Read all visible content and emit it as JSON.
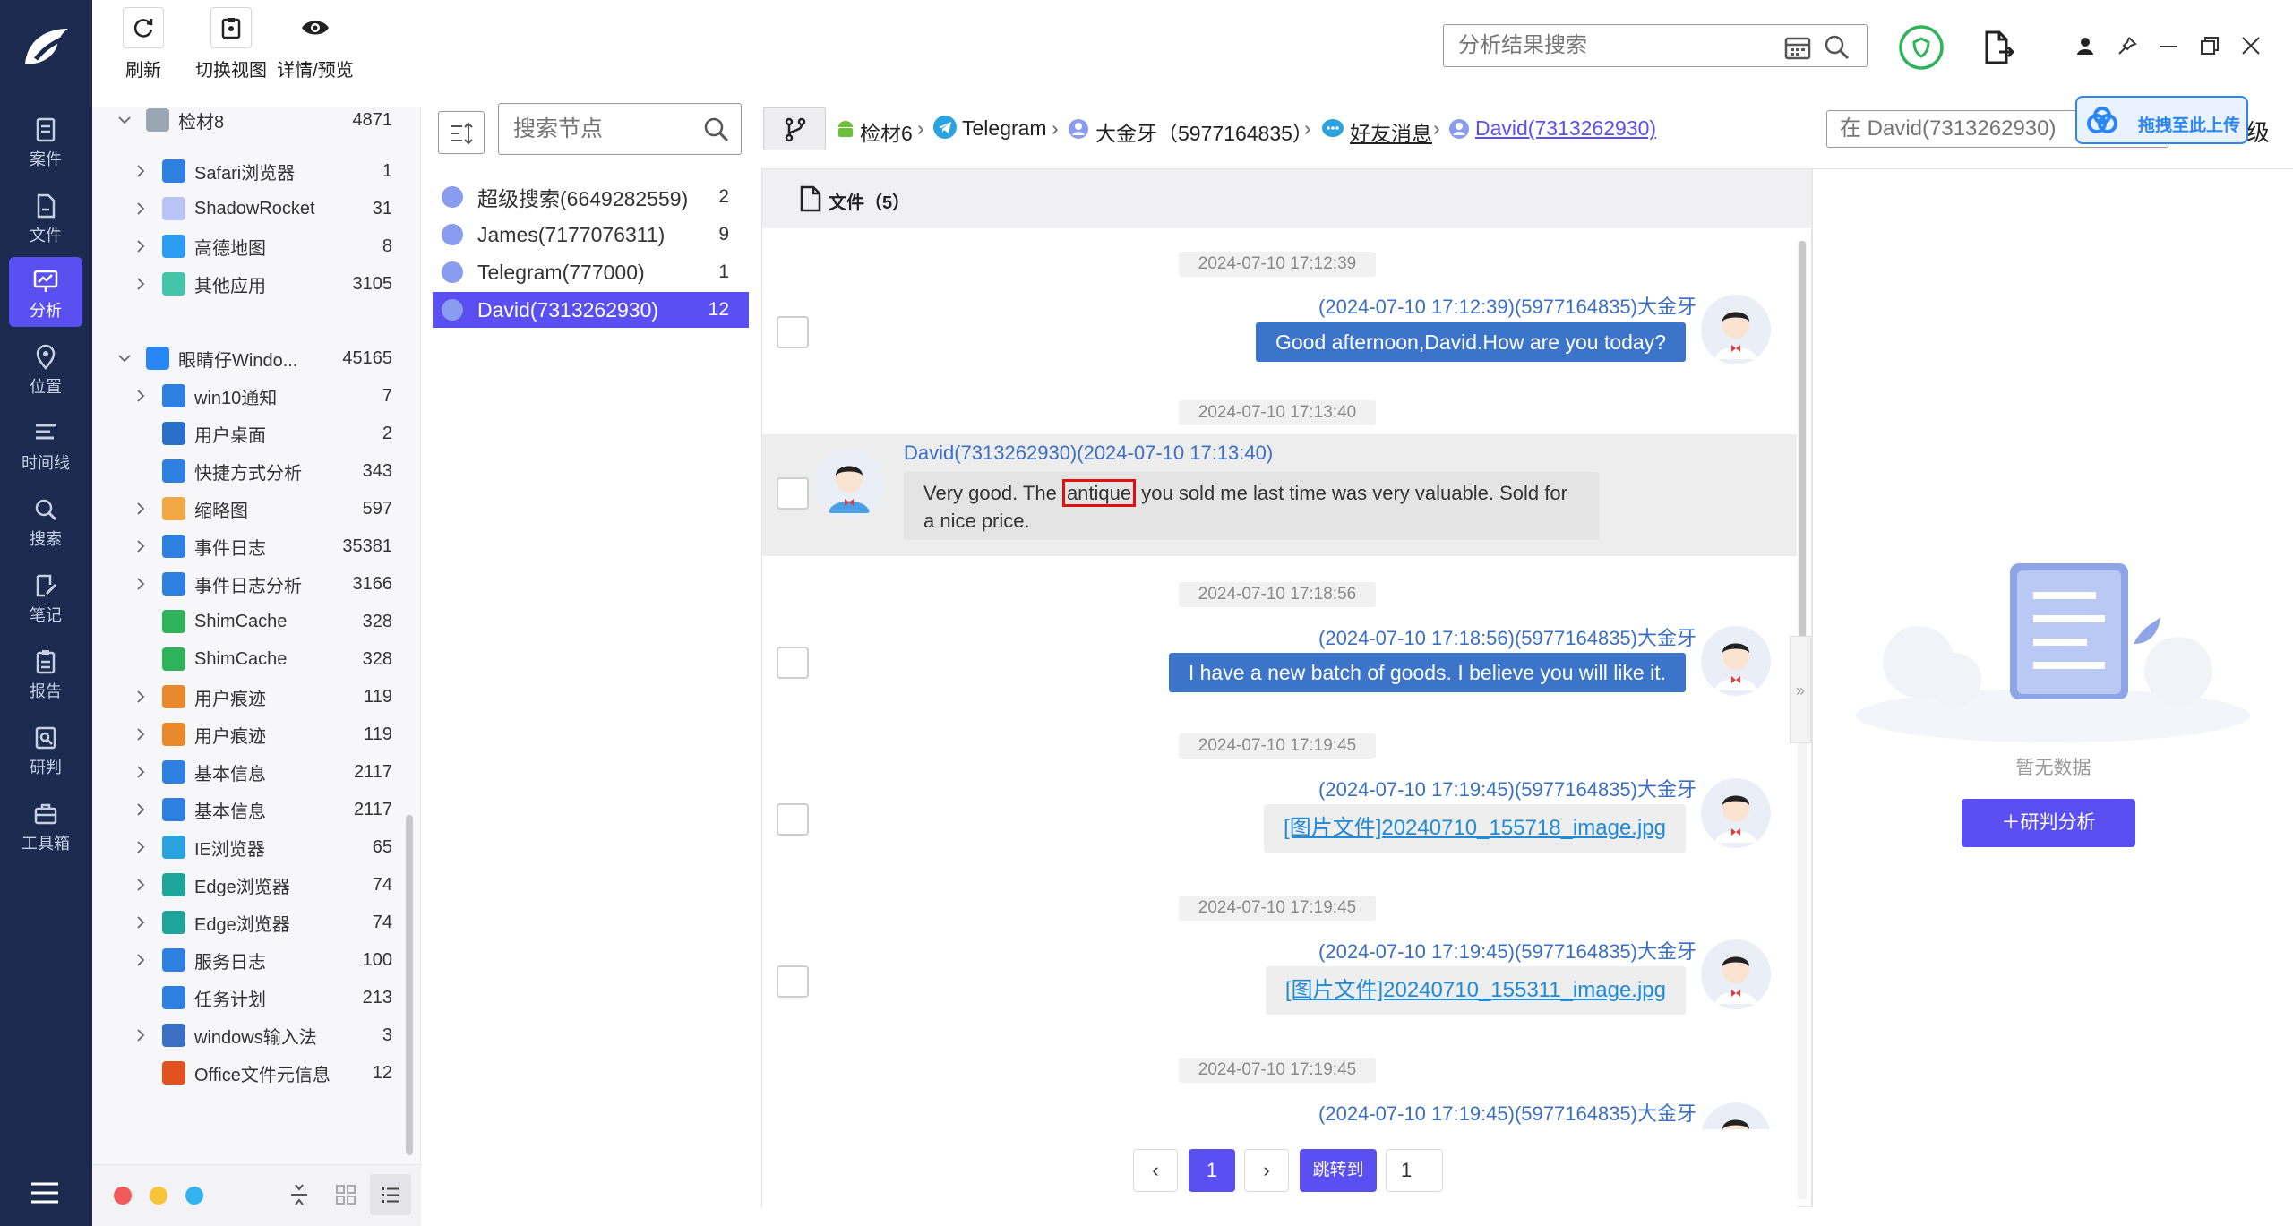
{
  "toolbar": {
    "refresh": "刷新",
    "switch_view": "切换视图",
    "details": "详情/预览",
    "search_placeholder": "分析结果搜索"
  },
  "rail": {
    "items": [
      "案件",
      "文件",
      "分析",
      "位置",
      "时间线",
      "搜索",
      "笔记",
      "报告",
      "研判",
      "工具箱"
    ],
    "active": "分析"
  },
  "tree": {
    "items": [
      {
        "label": "检材8",
        "count": "4871"
      },
      {
        "label": "Safari浏览器",
        "count": "1"
      },
      {
        "label": "ShadowRocket",
        "count": "31"
      },
      {
        "label": "高德地图",
        "count": "8"
      },
      {
        "label": "其他应用",
        "count": "3105"
      },
      {
        "label": "眼睛仔Windo...",
        "count": "45165"
      },
      {
        "label": "win10通知",
        "count": "7"
      },
      {
        "label": "用户桌面",
        "count": "2"
      },
      {
        "label": "快捷方式分析",
        "count": "343"
      },
      {
        "label": "缩略图",
        "count": "597"
      },
      {
        "label": "事件日志",
        "count": "35381"
      },
      {
        "label": "事件日志分析",
        "count": "3166"
      },
      {
        "label": "ShimCache",
        "count": "328"
      },
      {
        "label": "ShimCache",
        "count": "328"
      },
      {
        "label": "用户痕迹",
        "count": "119"
      },
      {
        "label": "用户痕迹",
        "count": "119"
      },
      {
        "label": "基本信息",
        "count": "2117"
      },
      {
        "label": "基本信息",
        "count": "2117"
      },
      {
        "label": "IE浏览器",
        "count": "65"
      },
      {
        "label": "Edge浏览器",
        "count": "74"
      },
      {
        "label": "Edge浏览器",
        "count": "74"
      },
      {
        "label": "服务日志",
        "count": "100"
      },
      {
        "label": "任务计划",
        "count": "213"
      },
      {
        "label": "windows输入法",
        "count": "3"
      },
      {
        "label": "Office文件元信息",
        "count": "12"
      }
    ]
  },
  "nodes": {
    "search_placeholder": "搜索节点",
    "items": [
      {
        "label": "超级搜索(6649282559)",
        "count": "2"
      },
      {
        "label": "James(7177076311)",
        "count": "9"
      },
      {
        "label": "Telegram(777000)",
        "count": "1"
      },
      {
        "label": "David(7313262930)",
        "count": "12"
      }
    ]
  },
  "breadcrumb": {
    "items": [
      "检材6",
      "Telegram",
      "大金牙（5977164835）",
      "好友消息",
      "David(7313262930)"
    ],
    "search_placeholder": "在 David(7313262930)",
    "level_suffix": "级",
    "upload_label": "拖拽至此上传"
  },
  "chat": {
    "header": "文件（5）",
    "messages": [
      {
        "time": "2024-07-10 17:12:39",
        "meta": "(2024-07-10 17:12:39)(5977164835)大金牙",
        "text": "Good afternoon,David.How are you today?"
      },
      {
        "time": "2024-07-10 17:13:40",
        "meta": "David(7313262930)(2024-07-10 17:13:40)",
        "text_before": "Very good. The ",
        "highlight": "antique",
        "text_after": " you sold me last time was very valuable. Sold for a nice price."
      },
      {
        "time": "2024-07-10 17:18:56",
        "meta": "(2024-07-10 17:18:56)(5977164835)大金牙",
        "text": "I have a new batch of goods. I believe you will like it."
      },
      {
        "time": "2024-07-10 17:19:45",
        "meta": "(2024-07-10 17:19:45)(5977164835)大金牙",
        "text": "[图片文件]20240710_155718_image.jpg"
      },
      {
        "time": "2024-07-10 17:19:45",
        "meta": "(2024-07-10 17:19:45)(5977164835)大金牙",
        "text": "[图片文件]20240710_155311_image.jpg"
      },
      {
        "time": "2024-07-10 17:19:45",
        "meta": "(2024-07-10 17:19:45)(5977164835)大金牙"
      }
    ]
  },
  "pager": {
    "current": "1",
    "jump_label": "跳转到",
    "jump_value": "1"
  },
  "side": {
    "empty_text": "暂无数据",
    "analyze_label": "＋研判分析"
  },
  "colors": {
    "rail_bg": "#1b2a4e",
    "accent": "#5a4ff0",
    "bubble": "#3b74c9",
    "link": "#1f8ad6"
  }
}
